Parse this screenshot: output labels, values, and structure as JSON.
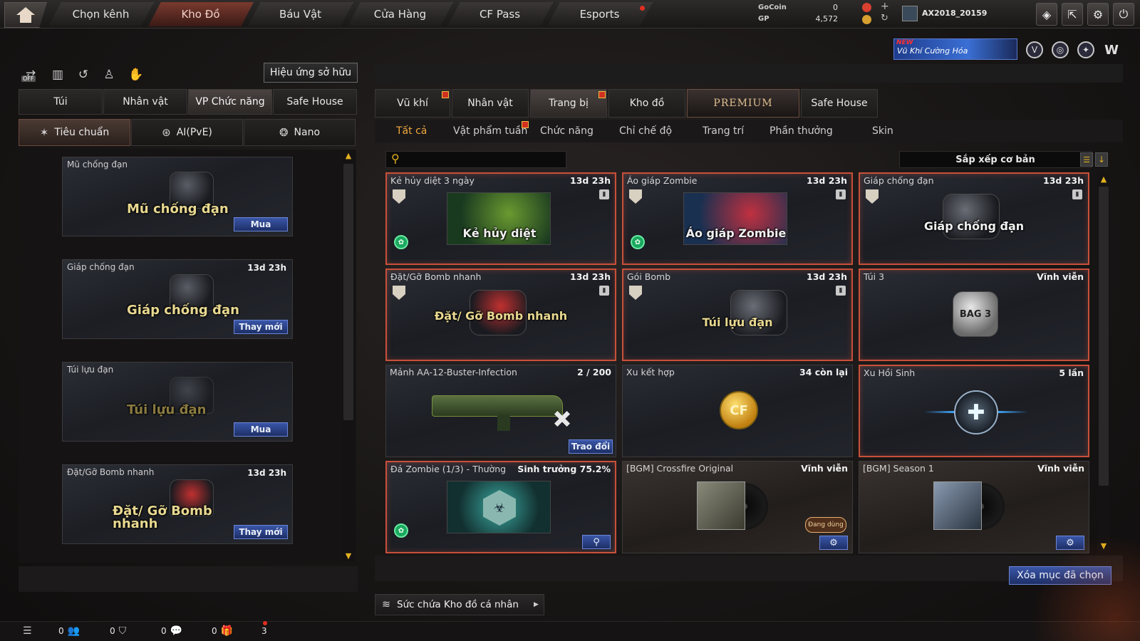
{
  "nav": {
    "tabs": [
      "Chọn kênh",
      "Kho Đồ",
      "Báu Vật",
      "Cửa Hàng",
      "CF Pass",
      "Esports"
    ],
    "active_tab": "Kho Đồ"
  },
  "currency": {
    "gocoin_label": "GoCoin",
    "gocoin_value": "0",
    "gp_label": "GP",
    "gp_value": "4,572"
  },
  "user": {
    "name": "AX2018_20159"
  },
  "promo": {
    "badge": "NEW",
    "text": "Vũ Khí Cường Hóa"
  },
  "left_panel": {
    "effect_button": "Hiệu ứng sở hữu",
    "off_badge": "OFF",
    "tabs": [
      "Túi",
      "Nhân vật",
      "VP Chức năng",
      "Safe House"
    ],
    "active_tab": "VP Chức năng",
    "subtabs": [
      "Tiêu chuẩn",
      "AI(PvE)",
      "Nano"
    ],
    "active_subtab": "Tiêu chuẩn",
    "items": [
      {
        "name": "Mũ chống đạn",
        "time": "",
        "art": "Mũ chống đạn",
        "button": "Mua"
      },
      {
        "name": "Giáp chống đạn",
        "time": "13d 23h",
        "art": "Giáp chống đạn",
        "button": "Thay mới"
      },
      {
        "name": "Túi lựu đạn",
        "time": "",
        "art": "Túi lựu đạn",
        "button": "Mua"
      },
      {
        "name": "Đặt/Gỡ Bomb nhanh",
        "time": "13d 23h",
        "art": "Đặt/ Gỡ Bomb nhanh",
        "button": "Thay mới"
      }
    ]
  },
  "right_panel": {
    "tabs": [
      "Vũ khí",
      "Nhân vật",
      "Trang bị",
      "Kho đồ",
      "PREMIUM",
      "Safe House"
    ],
    "active_tab": "Trang bị",
    "subtabs": [
      "Tất cả",
      "Vật phẩm tuần",
      "Chức năng",
      "Chỉ chế độ",
      "Trang trí",
      "Phần thưởng",
      "Skin"
    ],
    "active_subtab": "Tất cả",
    "search_placeholder": "",
    "sort_label": "Sắp xếp cơ bản",
    "items": [
      {
        "name": "Kẻ hủy diệt 3 ngày",
        "status": "13d 23h",
        "art": "Kẻ hủy diệt"
      },
      {
        "name": "Áo giáp Zombie",
        "status": "13d 23h",
        "art": "Áo giáp Zombie"
      },
      {
        "name": "Giáp chống đạn",
        "status": "13d 23h",
        "art": "Giáp chống đạn"
      },
      {
        "name": "Đặt/Gỡ Bomb nhanh",
        "status": "13d 23h",
        "art": "Đặt/ Gỡ Bomb nhanh"
      },
      {
        "name": "Gói Bomb",
        "status": "13d 23h",
        "art": "Túi lựu đạn"
      },
      {
        "name": "Túi 3",
        "status": "Vĩnh viễn",
        "art": "BAG 3"
      },
      {
        "name": "Mảnh AA-12-Buster-Infection",
        "status": "2 / 200",
        "button": "Trao đổi"
      },
      {
        "name": "Xu kết hợp",
        "status": "34 còn lại",
        "art": "CF"
      },
      {
        "name": "Xu Hồi Sinh",
        "status": "5 lần"
      },
      {
        "name": "Đá Zombie (1/3) - Thường",
        "status": "Sinh trưởng 75.2%"
      },
      {
        "name": "[BGM] Crossfire Original",
        "status": "Vĩnh viễn",
        "badge": "Đang dùng"
      },
      {
        "name": "[BGM] Season 1",
        "status": "Vĩnh viễn"
      }
    ],
    "delete_button": "Xóa mục đã chọn",
    "capacity_label": "Sức chứa Kho đồ cá nhân"
  },
  "bottom_bar": {
    "counters": [
      "0",
      "0",
      "0",
      "0"
    ],
    "notification_count": "3"
  },
  "colors": {
    "accent_red": "#c8503a",
    "button_blue": "#2a4488",
    "active_subtab": "#f0a840",
    "gold": "#e0b020"
  }
}
